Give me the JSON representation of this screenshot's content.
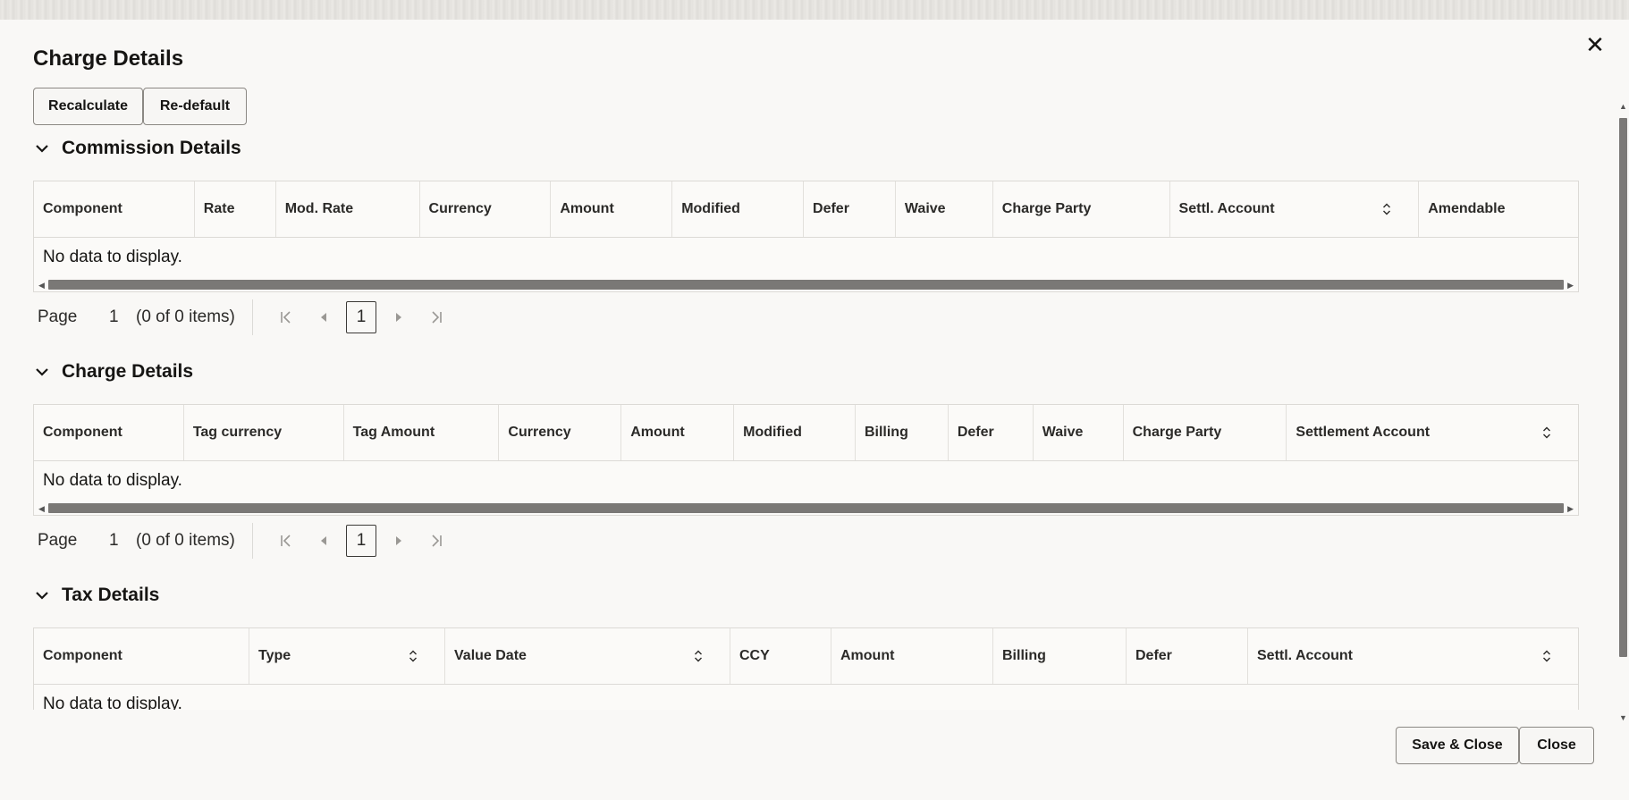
{
  "dialog": {
    "title": "Charge Details",
    "close_label": "✕"
  },
  "toolbar": {
    "recalculate_label": "Recalculate",
    "redefault_label": "Re-default"
  },
  "commission": {
    "title": "Commission Details",
    "columns": [
      "Component",
      "Rate",
      "Mod. Rate",
      "Currency",
      "Amount",
      "Modified",
      "Defer",
      "Waive",
      "Charge Party",
      "Settl. Account",
      "Amendable"
    ],
    "empty_text": "No data to display."
  },
  "charges": {
    "title": "Charge Details",
    "columns": [
      "Component",
      "Tag currency",
      "Tag Amount",
      "Currency",
      "Amount",
      "Modified",
      "Billing",
      "Defer",
      "Waive",
      "Charge Party",
      "Settlement Account"
    ],
    "empty_text": "No data to display."
  },
  "tax": {
    "title": "Tax Details",
    "columns": [
      "Component",
      "Type",
      "Value Date",
      "CCY",
      "Amount",
      "Billing",
      "Defer",
      "Settl. Account"
    ],
    "empty_text": "No data to display."
  },
  "pager": {
    "page_label": "Page",
    "page_value": "1",
    "items_text": "(0 of 0 items)",
    "current": "1"
  },
  "footer": {
    "save_close_label": "Save & Close",
    "close_label": "Close"
  }
}
